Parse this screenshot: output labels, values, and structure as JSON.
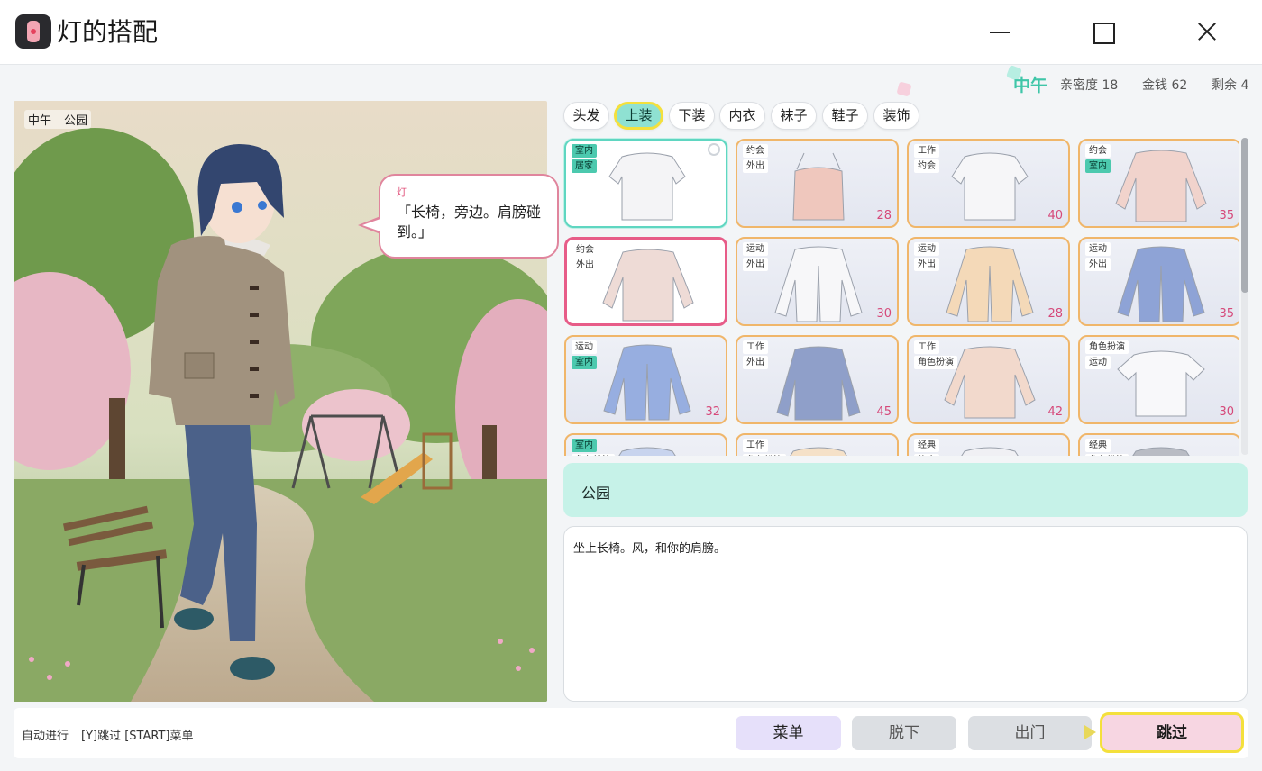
{
  "window": {
    "title": "灯的搭配",
    "icon": "lamp-icon",
    "controls": [
      "minimize-icon",
      "maximize-icon",
      "close-icon"
    ]
  },
  "status": {
    "time": "中午",
    "intimacy": "亲密度 18",
    "money": "金钱 62",
    "remaining": "剩余 4"
  },
  "scene": {
    "time": "中午",
    "location": "公园",
    "speaker": "灯",
    "line": "「长椅，旁边。肩膀碰到。」"
  },
  "tabs": [
    {
      "label": "头发",
      "active": false
    },
    {
      "label": "上装",
      "active": true
    },
    {
      "label": "下装",
      "active": false
    },
    {
      "label": "内衣",
      "active": false
    },
    {
      "label": "袜子",
      "active": false
    },
    {
      "label": "鞋子",
      "active": false
    },
    {
      "label": "装饰",
      "active": false
    }
  ],
  "items": [
    {
      "tags": [
        "室内",
        "居家"
      ],
      "price": "",
      "state": "equipped",
      "kind": "blouse",
      "color": "#f4f4f6"
    },
    {
      "tags": [
        "约会",
        "外出"
      ],
      "price": "28",
      "state": "",
      "kind": "camisole",
      "color": "#efc7bd"
    },
    {
      "tags": [
        "工作",
        "约会"
      ],
      "price": "40",
      "state": "",
      "kind": "blouse",
      "color": "#f6f6f8"
    },
    {
      "tags": [
        "约会",
        "室内"
      ],
      "price": "35",
      "state": "",
      "kind": "longsleeve",
      "color": "#f1d3cc"
    },
    {
      "tags": [
        "约会",
        "外出"
      ],
      "price": "",
      "state": "selected",
      "kind": "longsleeve",
      "color": "#eedbd6"
    },
    {
      "tags": [
        "运动",
        "外出"
      ],
      "price": "30",
      "state": "",
      "kind": "jacket",
      "color": "#f7f7f9"
    },
    {
      "tags": [
        "运动",
        "外出"
      ],
      "price": "28",
      "state": "",
      "kind": "jacket",
      "color": "#f4d9b8"
    },
    {
      "tags": [
        "运动",
        "外出"
      ],
      "price": "35",
      "state": "",
      "kind": "jacket",
      "color": "#8ea3d6"
    },
    {
      "tags": [
        "运动",
        "室内"
      ],
      "price": "32",
      "state": "",
      "kind": "jacket",
      "color": "#97aee0"
    },
    {
      "tags": [
        "工作",
        "外出"
      ],
      "price": "45",
      "state": "",
      "kind": "blazer",
      "color": "#8f9fc9"
    },
    {
      "tags": [
        "工作",
        "角色扮演"
      ],
      "price": "42",
      "state": "",
      "kind": "longsleeve",
      "color": "#f2d9cc"
    },
    {
      "tags": [
        "角色扮演",
        "运动"
      ],
      "price": "30",
      "state": "",
      "kind": "tshirt",
      "color": "#f8f8fa"
    },
    {
      "tags": [
        "室内",
        "角色扮演"
      ],
      "price": "",
      "state": "",
      "kind": "blouse",
      "color": "#c8d4ee"
    },
    {
      "tags": [
        "工作",
        "角色扮演"
      ],
      "price": "",
      "state": "",
      "kind": "blouse",
      "color": "#f5e1c8"
    },
    {
      "tags": [
        "经典",
        "约会"
      ],
      "price": "",
      "state": "",
      "kind": "blouse",
      "color": "#f0f0f4"
    },
    {
      "tags": [
        "经典",
        "角色扮演"
      ],
      "price": "",
      "state": "",
      "kind": "blouse",
      "color": "#b9bcc4"
    }
  ],
  "location_panel": {
    "name": "公园"
  },
  "description": {
    "text": "坐上长椅。风，和你的肩膀。"
  },
  "bottom": {
    "auto": "自动进行",
    "keys": "[Y]跳过 [START]菜单",
    "menu": "菜单",
    "undress": "脱下",
    "go_out": "出门",
    "skip": "跳过"
  },
  "colors": {
    "accent_teal": "#3fc6a8",
    "tab_active": "#8fe1d2",
    "focus_yellow": "#f4e03c",
    "price_pink": "#d6497a",
    "card_border": "#f0b66a",
    "selected_border": "#e75c88"
  }
}
